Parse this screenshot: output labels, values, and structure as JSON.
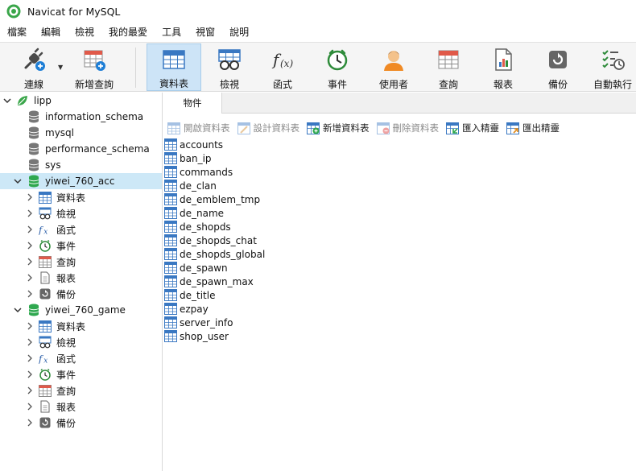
{
  "window": {
    "title": "Navicat for MySQL"
  },
  "menu": [
    "檔案",
    "編輯",
    "檢視",
    "我的最愛",
    "工具",
    "視窗",
    "說明"
  ],
  "toolbar": {
    "buttons": [
      {
        "id": "connection",
        "label": "連線",
        "icon": "connection-plug-icon",
        "has_dropdown": true
      },
      {
        "id": "new-query",
        "label": "新增查詢",
        "icon": "new-query-icon"
      },
      {
        "id": "tables",
        "label": "資料表",
        "icon": "table-grid-icon",
        "active": true
      },
      {
        "id": "views",
        "label": "檢視",
        "icon": "view-glasses-icon"
      },
      {
        "id": "functions",
        "label": "函式",
        "icon": "function-fx-icon"
      },
      {
        "id": "events",
        "label": "事件",
        "icon": "event-clock-icon"
      },
      {
        "id": "users",
        "label": "使用者",
        "icon": "user-person-icon"
      },
      {
        "id": "queries",
        "label": "查詢",
        "icon": "query-grid-icon"
      },
      {
        "id": "reports",
        "label": "報表",
        "icon": "report-document-icon"
      },
      {
        "id": "backup",
        "label": "備份",
        "icon": "backup-icon"
      },
      {
        "id": "automation",
        "label": "自動執行",
        "icon": "automation-checklist-icon"
      }
    ]
  },
  "nav": {
    "connection": {
      "label": "lipp",
      "expanded": true
    },
    "databases": [
      {
        "label": "information_schema",
        "expanded": false
      },
      {
        "label": "mysql",
        "expanded": false
      },
      {
        "label": "performance_schema",
        "expanded": false
      },
      {
        "label": "sys",
        "expanded": false
      },
      {
        "label": "yiwei_760_acc",
        "expanded": true,
        "selected": true,
        "children": [
          "資料表",
          "檢視",
          "函式",
          "事件",
          "查詢",
          "報表",
          "備份"
        ]
      },
      {
        "label": "yiwei_760_game",
        "expanded": true,
        "children": [
          "資料表",
          "檢視",
          "函式",
          "事件",
          "查詢",
          "報表",
          "備份"
        ]
      }
    ]
  },
  "content": {
    "tab_label": "物件",
    "object_toolbar": [
      {
        "label": "開啟資料表",
        "enabled": false,
        "icon": "open-table-icon"
      },
      {
        "label": "設計資料表",
        "enabled": false,
        "icon": "design-table-icon"
      },
      {
        "label": "新增資料表",
        "enabled": true,
        "icon": "new-table-icon"
      },
      {
        "label": "刪除資料表",
        "enabled": false,
        "icon": "delete-table-icon"
      },
      {
        "label": "匯入精靈",
        "enabled": true,
        "icon": "import-wizard-icon"
      },
      {
        "label": "匯出精靈",
        "enabled": true,
        "icon": "export-wizard-icon"
      }
    ],
    "tables": [
      "accounts",
      "ban_ip",
      "commands",
      "de_clan",
      "de_emblem_tmp",
      "de_name",
      "de_shopds",
      "de_shopds_chat",
      "de_shopds_global",
      "de_spawn",
      "de_spawn_max",
      "de_title",
      "ezpay",
      "server_info",
      "shop_user"
    ]
  },
  "colors": {
    "selection": "#cde8f7",
    "toolbar_active": "#cde4f7",
    "db_icon_active": "#2fa84f",
    "db_icon_inactive": "#7a7a7a",
    "table_icon_blue": "#3a78c2"
  }
}
